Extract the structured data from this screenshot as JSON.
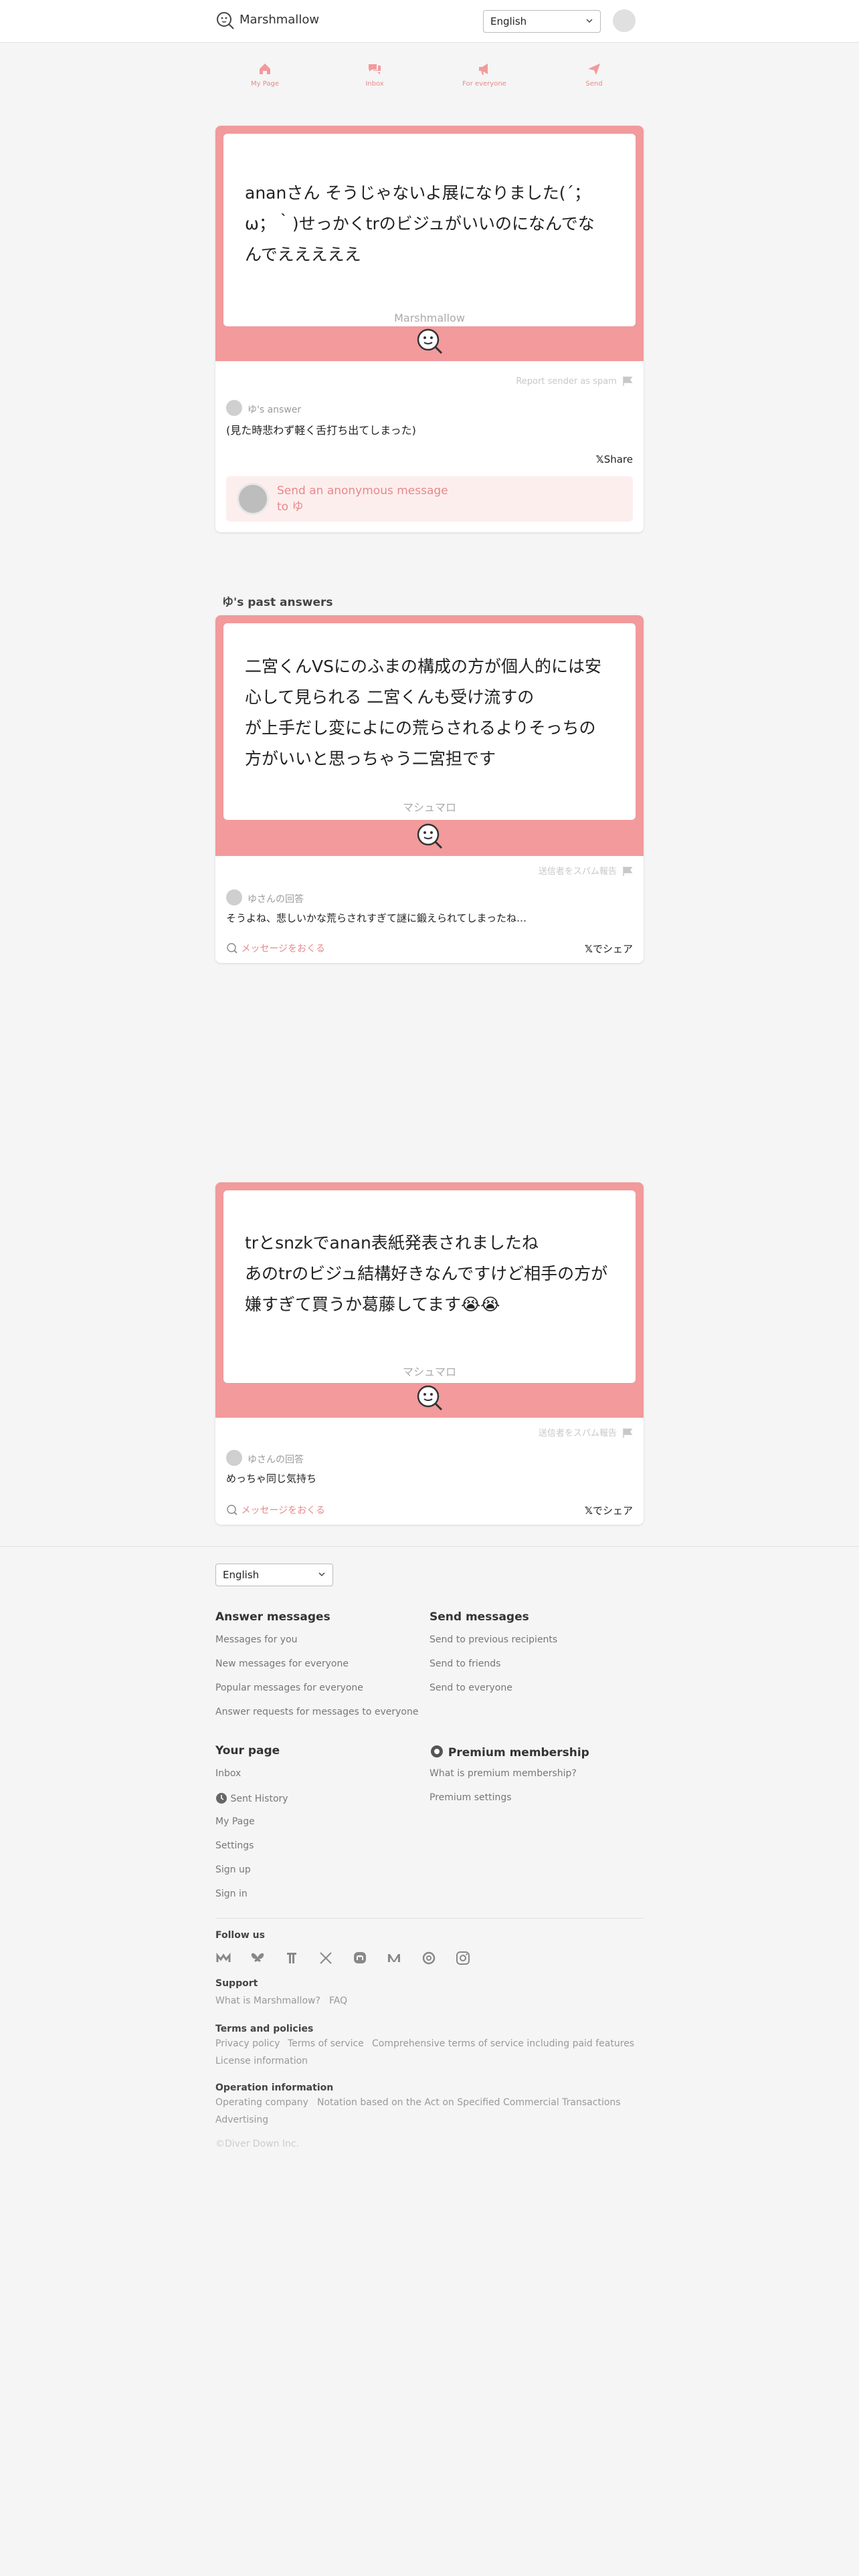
{
  "header": {
    "brand": "Marshmallow",
    "language": "English"
  },
  "nav": [
    {
      "label": "My Page",
      "icon": "home-icon"
    },
    {
      "label": "Inbox",
      "icon": "chat-bubbles-icon"
    },
    {
      "label": "For everyone",
      "icon": "megaphone-icon"
    },
    {
      "label": "Send",
      "icon": "paper-plane-icon"
    }
  ],
  "main_card": {
    "message_lines": [
      "ananさん そうじゃないよ展になりました(´；",
      "ω；｀)せっかくtrのビジュがいいのになんでな",
      "んでえええええ"
    ],
    "brand": "Marshmallow",
    "report": "Report sender as spam",
    "answer_label": "ゆ's answer",
    "answer": "(見た時悲わず軽く舌打ち出てしまった)",
    "share": "Share",
    "cta": "Send an anonymous message to ゆ"
  },
  "past_section_title": "ゆ's past answers",
  "past_cards": [
    {
      "message_lines": [
        "二宮くんVSにのふまの構成の方が個人的には安",
        "心して見られる 二宮くんも受け流すの",
        "が上手だし変によにの荒らされるよりそっちの",
        "方がいいと思っちゃう二宮担です"
      ],
      "brand": "マシュマロ",
      "report": "送信者をスパム報告",
      "answer_label": "ゆさんの回答",
      "answer": "そうよね、悲しいかな荒らされすぎて謎に鍛えられてしまったね…",
      "more": "メッセージをおくる",
      "share": "でシェア"
    },
    {
      "message_lines": [
        "trとsnzkでanan表紙発表されましたね",
        "あのtrのビジュ結構好きなんですけど相手の方が",
        "嫌すぎて買うか葛藤してます😭😭"
      ],
      "brand": "マシュマロ",
      "report": "送信者をスパム報告",
      "answer_label": "ゆさんの回答",
      "answer": "めっちゃ同じ気持ち",
      "more": "メッセージをおくる",
      "share": "でシェア"
    }
  ],
  "footer": {
    "language": "English",
    "answer_head": "Answer messages",
    "answer_links": [
      "Messages for you",
      "New messages for everyone",
      "Popular messages for everyone",
      "Answer requests for messages to everyone"
    ],
    "send_head": "Send messages",
    "send_links": [
      "Send to previous recipients",
      "Send to friends",
      "Send to everyone"
    ],
    "page_head": "Your page",
    "page_links": [
      "Inbox",
      "Sent History",
      "My Page",
      "Settings",
      "Sign up",
      "Sign in"
    ],
    "premium_head": "Premium membership",
    "premium_links": [
      "What is premium membership?",
      "Premium settings"
    ],
    "follow_head": "Follow us",
    "support_head": "Support",
    "support_links": [
      "What is Marshmallow?",
      "FAQ"
    ],
    "terms_head": "Terms and policies",
    "terms_links": [
      "Privacy policy",
      "Terms of service",
      "Comprehensive terms of service including paid features"
    ],
    "license": "License information",
    "ops_head": "Operation information",
    "ops_links": [
      "Operating company",
      "Notation based on the Act on Specified Commercial Transactions"
    ],
    "advertising": "Advertising",
    "copyright": "©Diver Down Inc."
  },
  "colors": {
    "accent": "#f29a9c",
    "accent_text": "#e8888b",
    "cta_bg": "#fdeeee"
  }
}
